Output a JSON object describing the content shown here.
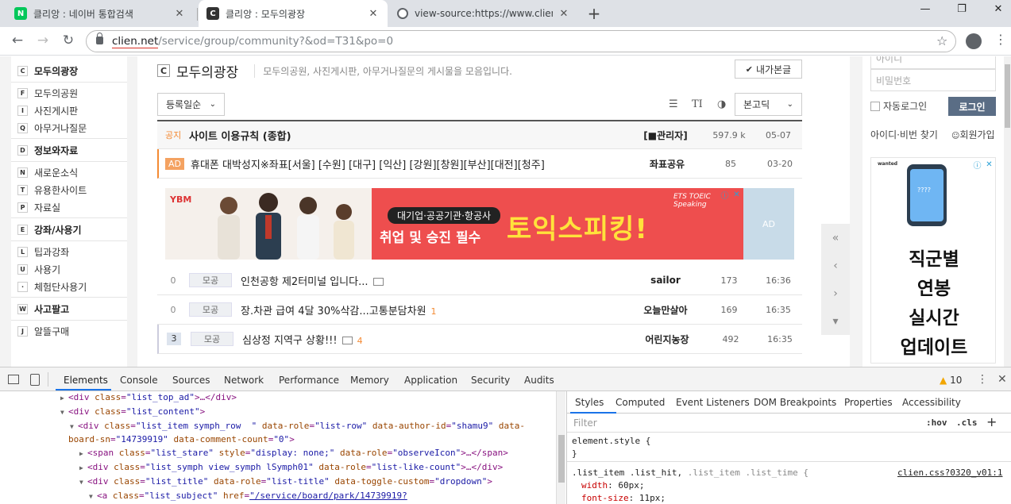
{
  "browser": {
    "tabs": [
      {
        "label": "클리앙 : 네이버 통합검색",
        "favicon": "N",
        "favicon_color": "#03c75a"
      },
      {
        "label": "클리앙 : 모두의광장",
        "favicon": "C",
        "favicon_color": "#333333"
      },
      {
        "label": "view-source:https://www.clien.ne",
        "favicon": "globe-icon",
        "favicon_color": "#5f6368"
      }
    ],
    "new_tab": "+",
    "window_controls": {
      "minimize": "—",
      "maximize": "❐",
      "close": "✕"
    },
    "url_host": "clien.net",
    "url_path": "/service/group/community?&od=T31&po=0"
  },
  "sidebar": {
    "groups": [
      {
        "key": "C",
        "label": "모두의광장",
        "items": [
          {
            "key": "F",
            "label": "모두의공원"
          },
          {
            "key": "I",
            "label": "사진게시판"
          },
          {
            "key": "Q",
            "label": "아무거나질문"
          }
        ]
      },
      {
        "key": "D",
        "label": "정보와자료",
        "items": [
          {
            "key": "N",
            "label": "새로운소식"
          },
          {
            "key": "T",
            "label": "유용한사이트"
          },
          {
            "key": "P",
            "label": "자료실"
          }
        ]
      },
      {
        "key": "E",
        "label": "강좌/사용기",
        "items": [
          {
            "key": "L",
            "label": "팁과강좌"
          },
          {
            "key": "U",
            "label": "사용기"
          },
          {
            "key": "·",
            "label": "체험단사용기"
          }
        ]
      },
      {
        "key": "W",
        "label": "사고팔고",
        "items": [
          {
            "key": "J",
            "label": "알뜰구매"
          }
        ]
      }
    ]
  },
  "board": {
    "logo": "C",
    "title": "모두의광장",
    "description": "모두의공원, 사진게시판, 아무거나질문의 게시물을 모음입니다.",
    "my_posts": "내가본글",
    "sort": "등록일순",
    "font": "본고딕",
    "tool_icons": [
      "list-icon",
      "text-size-icon",
      "contrast-icon"
    ]
  },
  "notice_row": {
    "badge": "공지",
    "title": "사이트 이용규칙 (종합)",
    "author": "[■관리자]",
    "hits": "597.9 k",
    "time": "05-07"
  },
  "ad_row": {
    "badge": "AD",
    "title": "휴대폰 대박성지※좌표[서울] [수원] [대구] [익산] [강원][창원][부산][대전][청주]",
    "author": "좌표공유",
    "hits": "85",
    "time": "03-20"
  },
  "banner": {
    "logo": "YBM",
    "tag": "대기업·공공기관·항공사",
    "sub": "취업 및 승진 필수",
    "main": "토익스피킹!",
    "ets": "ETS TOEIC Speaking",
    "ad_label": "AD"
  },
  "posts": [
    {
      "count": "0",
      "category": "모공",
      "title": "인천공항 제2터미널 입니다...",
      "has_image": true,
      "comments": "",
      "author": "sailor",
      "hits": "173",
      "time": "16:36"
    },
    {
      "count": "0",
      "category": "모공",
      "title": "장.차관 급여 4달 30%삭감...고통분담차원",
      "has_image": false,
      "comments": "1",
      "author": "오늘만살아",
      "hits": "169",
      "time": "16:35"
    },
    {
      "count": "3",
      "category": "모공",
      "title": "심상정 지역구 상황!!!",
      "has_image": true,
      "comments": "4",
      "author": "어린지농장",
      "hits": "492",
      "time": "16:35"
    }
  ],
  "side_controls": [
    "«",
    "‹",
    "›",
    "▾"
  ],
  "login": {
    "id_placeholder": "아이디",
    "pw_placeholder": "비밀번호",
    "auto_login": "자동로그인",
    "login_button": "로그인",
    "find": "아이디·비번 찾기",
    "join": "회원가입"
  },
  "right_ad": {
    "brand": "wanted",
    "screen_text": "????",
    "lines": [
      "직군별",
      "연봉",
      "실시간",
      "업데이트"
    ]
  },
  "devtools": {
    "tabs": [
      "Elements",
      "Console",
      "Sources",
      "Network",
      "Performance",
      "Memory",
      "Application",
      "Security",
      "Audits"
    ],
    "warnings": "10",
    "style_tabs": [
      "Styles",
      "Computed",
      "Event Listeners",
      "DOM Breakpoints",
      "Properties",
      "Accessibility"
    ],
    "filter_placeholder": "Filter",
    "hov": ":hov",
    "cls": ".cls",
    "element_style": "element.style {",
    "close_brace": "}",
    "rule_selector_1": ".list_item .list_hit,",
    "rule_selector_2": ".list_item .list_time {",
    "rule_source": "clien.css?0320_v01:1",
    "prop1_name": "width",
    "prop1_value": "60px;",
    "prop2_name": "font-size",
    "prop2_value": "11px;"
  }
}
